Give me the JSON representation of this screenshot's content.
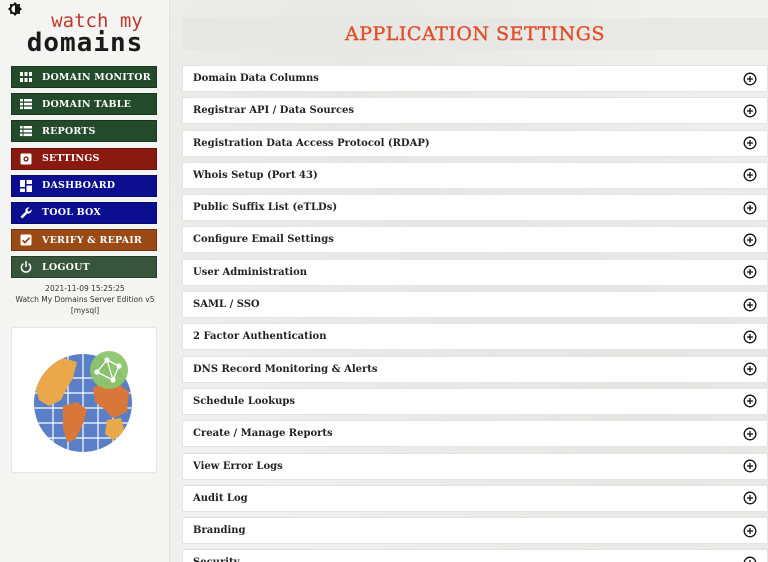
{
  "sidebar": {
    "logo": {
      "line1": "watch my",
      "line2": "domains"
    },
    "menu": [
      {
        "label": "DOMAIN MONITOR",
        "icon": "grid-icon",
        "color": "#224a2b"
      },
      {
        "label": "DOMAIN TABLE",
        "icon": "table-icon",
        "color": "#224a2b"
      },
      {
        "label": "REPORTS",
        "icon": "list-icon",
        "color": "#224a2b"
      },
      {
        "label": "SETTINGS",
        "icon": "settings-icon",
        "color": "#8a1a10"
      },
      {
        "label": "DASHBOARD",
        "icon": "dashboard-icon",
        "color": "#0b0f8f"
      },
      {
        "label": "TOOL BOX",
        "icon": "wrench-icon",
        "color": "#0b0f8f"
      },
      {
        "label": "VERIFY & REPAIR",
        "icon": "checkbox-icon",
        "color": "#9a4a14"
      },
      {
        "label": "LOGOUT",
        "icon": "power-icon",
        "color": "#37553b"
      }
    ],
    "meta": {
      "timestamp": "2021-11-09 15:25:25",
      "edition": "Watch My Domains Server Edition v5",
      "db": "[mysql]"
    }
  },
  "main": {
    "title": "APPLICATION SETTINGS",
    "accent_color": "#e0502a",
    "settings": [
      "Domain Data Columns",
      "Registrar API / Data Sources",
      "Registration Data Access Protocol (RDAP)",
      "Whois Setup (Port 43)",
      "Public Suffix List (eTLDs)",
      "Configure Email Settings",
      "User Administration",
      "SAML / SSO",
      "2 Factor Authentication",
      "DNS Record Monitoring & Alerts",
      "Schedule Lookups",
      "Create / Manage Reports",
      "View Error Logs",
      "Audit Log",
      "Branding",
      "Security"
    ]
  }
}
